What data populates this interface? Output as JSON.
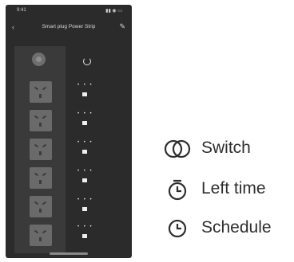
{
  "phone": {
    "status_time": "9:41",
    "status_icons": "▮▮ ◉ ▭",
    "title": "Smart plug Power Strip",
    "back_icon": "chevron-left-icon",
    "edit_icon": "pencil-icon",
    "outlets": 6,
    "outlet_controls": [
      "• • •",
      "• • •",
      "• • •",
      "• • •",
      "• • •",
      "• • •"
    ]
  },
  "legend": [
    {
      "icon": "switch-icon",
      "label": "Switch"
    },
    {
      "icon": "timer-icon",
      "label": "Left time"
    },
    {
      "icon": "clock-icon",
      "label": "Schedule"
    }
  ]
}
